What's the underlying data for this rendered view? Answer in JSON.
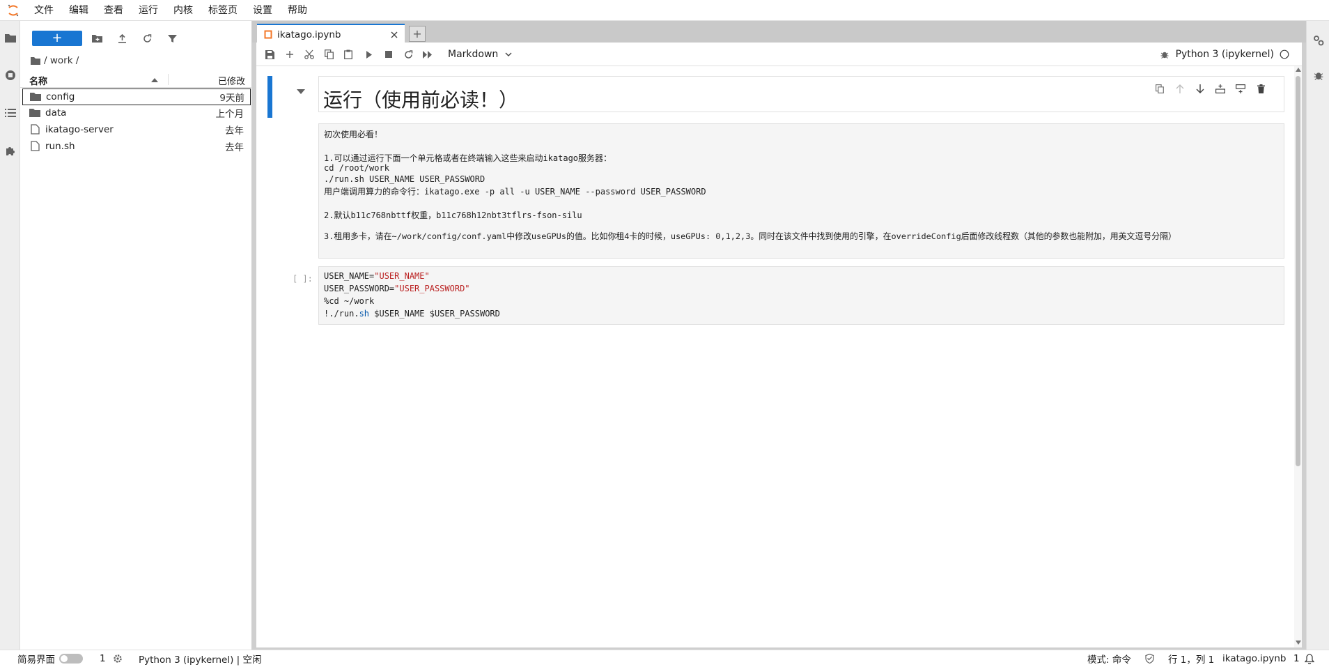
{
  "menubar": {
    "items": [
      "文件",
      "编辑",
      "查看",
      "运行",
      "内核",
      "标签页",
      "设置",
      "帮助"
    ]
  },
  "filebrowser": {
    "new_label": "+",
    "breadcrumb": "/ work /",
    "header": {
      "name": "名称",
      "modified": "已修改"
    },
    "files": [
      {
        "name": "config",
        "modified": "9天前",
        "type": "folder"
      },
      {
        "name": "data",
        "modified": "上个月",
        "type": "folder"
      },
      {
        "name": "ikatago-server",
        "modified": "去年",
        "type": "file"
      },
      {
        "name": "run.sh",
        "modified": "去年",
        "type": "file"
      }
    ]
  },
  "tab": {
    "title": "ikatago.ipynb",
    "add_label": "+"
  },
  "notebook_toolbar": {
    "cell_type": "Markdown",
    "kernel": "Python 3 (ipykernel)"
  },
  "cells": {
    "heading": "运行（使用前必读！）",
    "markdown_lines": [
      "初次使用必看！",
      "",
      "1.可以通过运行下面一个单元格或者在终端输入这些来启动ikatago服务器：",
      "cd /root/work",
      "./run.sh USER_NAME USER_PASSWORD",
      "用户端调用算力的命令行：ikatago.exe -p all -u USER_NAME --password USER_PASSWORD",
      "",
      "2.默认b11c768nbttf权重，b11c768h12nbt3tflrs-fson-silu",
      "",
      "3.租用多卡，请在~/work/config/conf.yaml中修改useGPUs的值。比如你租4卡的时候，useGPUs: 0,1,2,3。同时在该文件中找到使用的引擎，在overrideConfig后面修改线程数（其他的参数也能附加，用英文逗号分隔）"
    ],
    "code_prompt": "[ ]:",
    "code": {
      "line1_a": "USER_NAME=",
      "line1_b": "\"USER_NAME\"",
      "line2_a": "USER_PASSWORD=",
      "line2_b": "\"USER_PASSWORD\"",
      "line3": "%cd ~/work",
      "line4_a": "!./run.",
      "line4_b": "sh",
      "line4_c": " $USER_NAME $USER_PASSWORD"
    }
  },
  "statusbar": {
    "simple_mode": "简易界面",
    "terminals": "1",
    "kernel_status": "Python 3 (ipykernel) | 空闲",
    "mode": "模式: 命令",
    "position": "行 1，列 1",
    "filename": "ikatago.ipynb",
    "notifications": "1"
  },
  "colors": {
    "accent": "#1976d2",
    "string": "#ba2121",
    "keyword": "#0055aa"
  }
}
